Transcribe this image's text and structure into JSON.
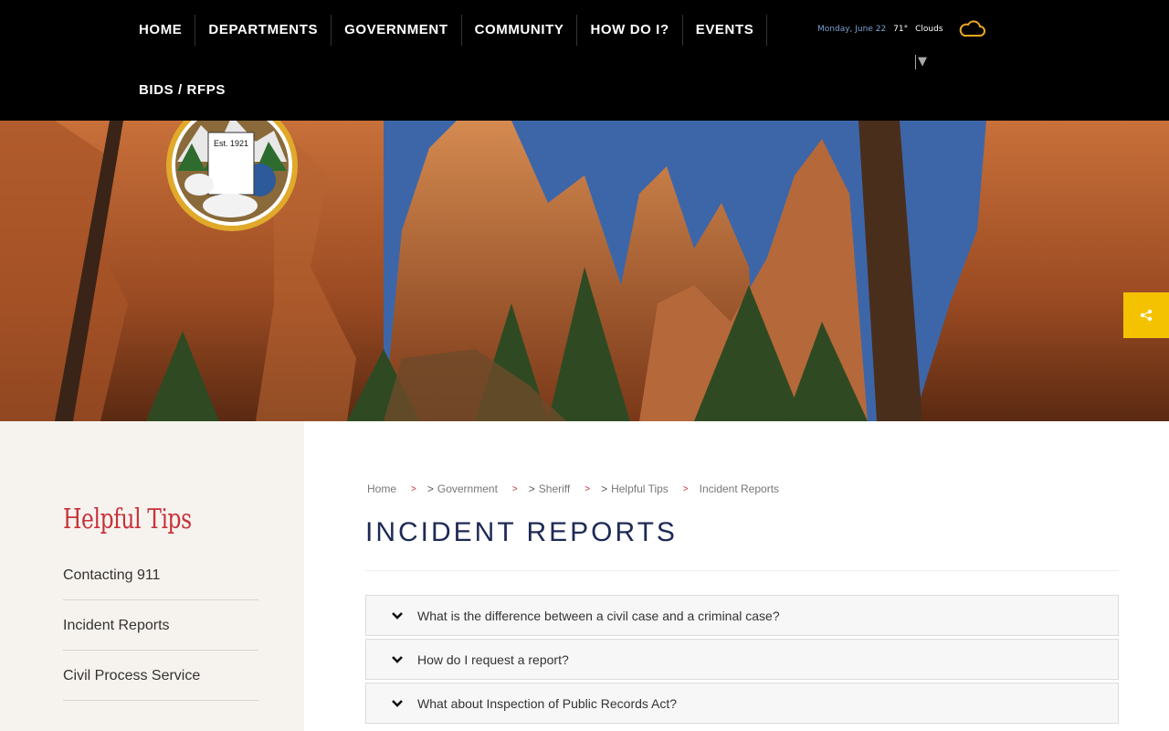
{
  "header": {
    "nav_items": [
      "HOME",
      "DEPARTMENTS",
      "GOVERNMENT",
      "COMMUNITY",
      "HOW DO I?",
      "EVENTS"
    ],
    "nav_row2": [
      "BIDS / RFPS"
    ],
    "weather": {
      "date": "Monday, June 22",
      "temp": "71°",
      "condition": "Clouds",
      "icon": "cloud-icon"
    },
    "lang_selector": "▼"
  },
  "seal": {
    "est": "Est. 1921"
  },
  "share": {
    "icon": "share-icon",
    "color": "#f5c200"
  },
  "sidebar": {
    "title": "Helpful Tips",
    "items": [
      "Contacting 911",
      "Incident Reports",
      "Civil Process Service"
    ]
  },
  "breadcrumb": {
    "items": [
      "Home",
      "Government",
      "Sheriff",
      "Helpful Tips",
      "Incident Reports"
    ],
    "separator": ">"
  },
  "main": {
    "title": "INCIDENT REPORTS",
    "faq": [
      "What is the difference between a civil case and a criminal case?",
      "How do I request a report?",
      "What about Inspection of Public Records Act?"
    ]
  },
  "colors": {
    "header_bg": "#000000",
    "title": "#1e2a55",
    "accent_red": "#c8303a",
    "sidebar_bg": "#f6f3ee"
  }
}
